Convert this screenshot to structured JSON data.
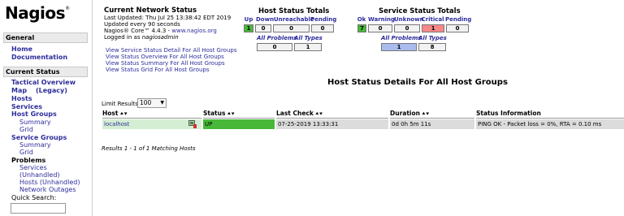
{
  "sidebar": {
    "logo_text": "Nagios",
    "logo_mark": "®",
    "general_header": "General",
    "general_items": [
      "Home",
      "Documentation"
    ],
    "current_status_header": "Current Status",
    "status_items": {
      "tactical": "Tactical Overview",
      "map": "Map",
      "map_legacy": "(Legacy)",
      "hosts": "Hosts",
      "services": "Services",
      "host_groups": "Host Groups",
      "hg_summary": "Summary",
      "hg_grid": "Grid",
      "service_groups": "Service Groups",
      "sg_summary": "Summary",
      "sg_grid": "Grid",
      "problems": "Problems",
      "p_services": "Services",
      "p_unhandled": "(Unhandled)",
      "p_hosts_unhandled": "Hosts (Unhandled)",
      "p_network_outages": "Network Outages"
    },
    "quick_search_label": "Quick Search:",
    "quick_search_value": ""
  },
  "network_status": {
    "title": "Current Network Status",
    "last_updated": "Last Updated: Thu Jul 25 13:38:42 EDT 2019",
    "update_interval": "Updated every 90 seconds",
    "version_prefix": "Nagios® Core™ 4.4.3 - ",
    "version_link": "www.nagios.org",
    "logged_in_prefix": "Logged in as ",
    "logged_in_user": "nagiosadmin"
  },
  "view_links": [
    "View Service Status Detail For All Host Groups",
    "View Status Overview For All Host Groups",
    "View Status Summary For All Host Groups",
    "View Status Grid For All Host Groups"
  ],
  "host_totals": {
    "title": "Host Status Totals",
    "headers": [
      "Up",
      "Down",
      "Unreachable",
      "Pending"
    ],
    "values": [
      "1",
      "0",
      "0",
      "0"
    ],
    "all_problems_label": "All Problems",
    "all_types_label": "All Types",
    "all_problems_value": "0",
    "all_types_value": "1"
  },
  "service_totals": {
    "title": "Service Status Totals",
    "headers": [
      "Ok",
      "Warning",
      "Unknown",
      "Critical",
      "Pending"
    ],
    "values": [
      "7",
      "0",
      "0",
      "1",
      "0"
    ],
    "all_problems_label": "All Problems",
    "all_types_label": "All Types",
    "all_problems_value": "1",
    "all_types_value": "8"
  },
  "main": {
    "heading": "Host Status Details For All Host Groups",
    "limit_label": "Limit Results:",
    "limit_value": "100",
    "columns": [
      "Host",
      "Status",
      "Last Check",
      "Duration",
      "Status Information"
    ],
    "sort_glyph": "⯅⯆",
    "rows": [
      {
        "host": "localhost",
        "status": "UP",
        "last_check": "07-25-2019 13:33:31",
        "duration": "0d 0h 5m 11s",
        "info": "PING OK - Packet loss = 0%, RTA = 0.10 ms"
      }
    ],
    "matching": "Results 1 - 1 of 1 Matching Hosts"
  },
  "colors": {
    "up": "#47b838",
    "critical": "#f88888",
    "link": "#2d2d9c",
    "problems_cell": "#aabbee"
  }
}
